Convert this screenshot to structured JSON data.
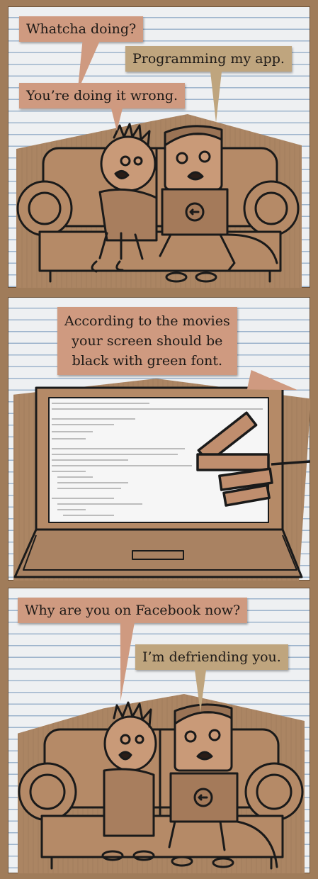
{
  "panels": [
    {
      "bubbles": {
        "b1": "Whatcha doing?",
        "b2": "Programming my app.",
        "b3": "You’re doing it wrong."
      }
    },
    {
      "bubbles": {
        "b1_line1": "According to the movies",
        "b1_line2": "your screen should be",
        "b1_line3": "black with green font."
      }
    },
    {
      "bubbles": {
        "b1": "Why are you on Facebook now?",
        "b2": "I’m defriending you."
      }
    }
  ],
  "colors": {
    "bubble_pink": "#cf9a80",
    "bubble_tan": "#bfa57e",
    "cardboard": "#ab8563",
    "paper_line": "#9db4cc",
    "ink": "#1a1a1a"
  }
}
